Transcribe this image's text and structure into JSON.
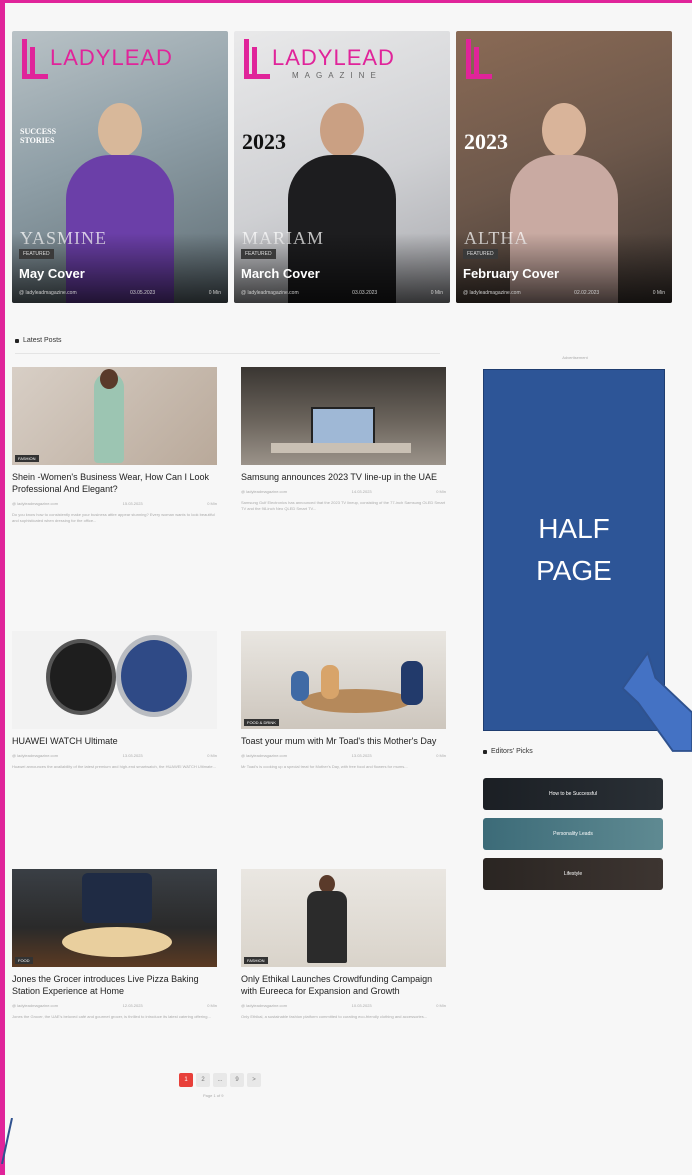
{
  "covers": [
    {
      "logo": "LADYLEAD",
      "name_overlay": "YASMINE",
      "heading": "SUCCESS STORIES",
      "year": "",
      "tag": "Featured",
      "title": "May Cover",
      "meta_left": "@ ladyleadmagazine.com",
      "meta_mid": "03.05.2023",
      "meta_right": "0 Min"
    },
    {
      "logo": "LADYLEAD",
      "logo_sub": "MAGAZINE",
      "name_overlay": "MARIAM",
      "heading": "",
      "year": "2023",
      "tag": "Featured",
      "title": "March Cover",
      "meta_left": "@ ladyleadmagazine.com",
      "meta_mid": "03.03.2023",
      "meta_right": "0 Min"
    },
    {
      "logo": "",
      "name_overlay": "ALTHA",
      "heading": "",
      "year": "2023",
      "tag": "Featured",
      "title": "February Cover",
      "meta_left": "@ ladyleadmagazine.com",
      "meta_mid": "02.02.2023",
      "meta_right": "0 Min"
    }
  ],
  "latest_heading": "Latest Posts",
  "posts": [
    {
      "title": "Shein -Women's Business Wear, How Can I Look Professional And Elegant?",
      "category": "Fashion",
      "meta_left": "@ ladyleadmagazine.com",
      "meta_mid": "15.03.2023",
      "meta_right": "0 Min",
      "excerpt": "Do you know how to consistently make your business attire appear stunning? Every woman wants to look beautiful and sophisticated when dressing for the office..."
    },
    {
      "title": "Samsung announces 2023 TV line-up in the UAE",
      "category": "",
      "meta_left": "@ ladyleadmagazine.com",
      "meta_mid": "14.03.2023",
      "meta_right": "0 Min",
      "excerpt": "Samsung Gulf Electronics has announced that the 2023 TV lineup, consisting of the 77-inch Samsung OLED Smart TV and the 98-inch Neo QLED Smart TV..."
    },
    {
      "title": "HUAWEI WATCH Ultimate",
      "category": "",
      "meta_left": "@ ladyleadmagazine.com",
      "meta_mid": "13.03.2023",
      "meta_right": "0 Min",
      "excerpt": "Huawei announces the availability of the latest premium and high-end smartwatch, the HUAWEI WATCH Ultimate..."
    },
    {
      "title": "Toast your mum with Mr Toad's this Mother's Day",
      "category": "Food & Drink",
      "meta_left": "@ ladyleadmagazine.com",
      "meta_mid": "13.03.2023",
      "meta_right": "0 Min",
      "excerpt": "Mr Toad's is cooking up a special treat for Mother's Day, with free food and flowers for mums..."
    },
    {
      "title": "Jones the Grocer introduces Live Pizza Baking Station Experience at Home",
      "category": "Food",
      "meta_left": "@ ladyleadmagazine.com",
      "meta_mid": "12.03.2023",
      "meta_right": "0 Min",
      "excerpt": "Jones the Grocer, the UAE's beloved café and gourmet grocer, is thrilled to introduce its latest catering offering..."
    },
    {
      "title": "Only Ethikal Launches Crowdfunding Campaign with Eureeca for Expansion and Growth",
      "category": "Fashion",
      "meta_left": "@ ladyleadmagazine.com",
      "meta_mid": "10.03.2023",
      "meta_right": "0 Min",
      "excerpt": "Only Ethikal, a sustainable fashion platform committed to curating eco-friendly clothing and accessories..."
    }
  ],
  "ad": {
    "label": "Advertisement",
    "line1": "HALF",
    "line2": "PAGE",
    "color": "#2d5597"
  },
  "editors_heading": "Editors' Picks",
  "picks": [
    {
      "label": "How to be Successful"
    },
    {
      "label": "Personality Leads"
    },
    {
      "label": "Lifestyle"
    }
  ],
  "pagination": {
    "pages": [
      "1",
      "2",
      "...",
      "9",
      ">"
    ],
    "active": "1",
    "of_text": "Page 1 of 9"
  },
  "colors": {
    "accent_pink": "#e0249a",
    "pager_active": "#e8403a"
  }
}
